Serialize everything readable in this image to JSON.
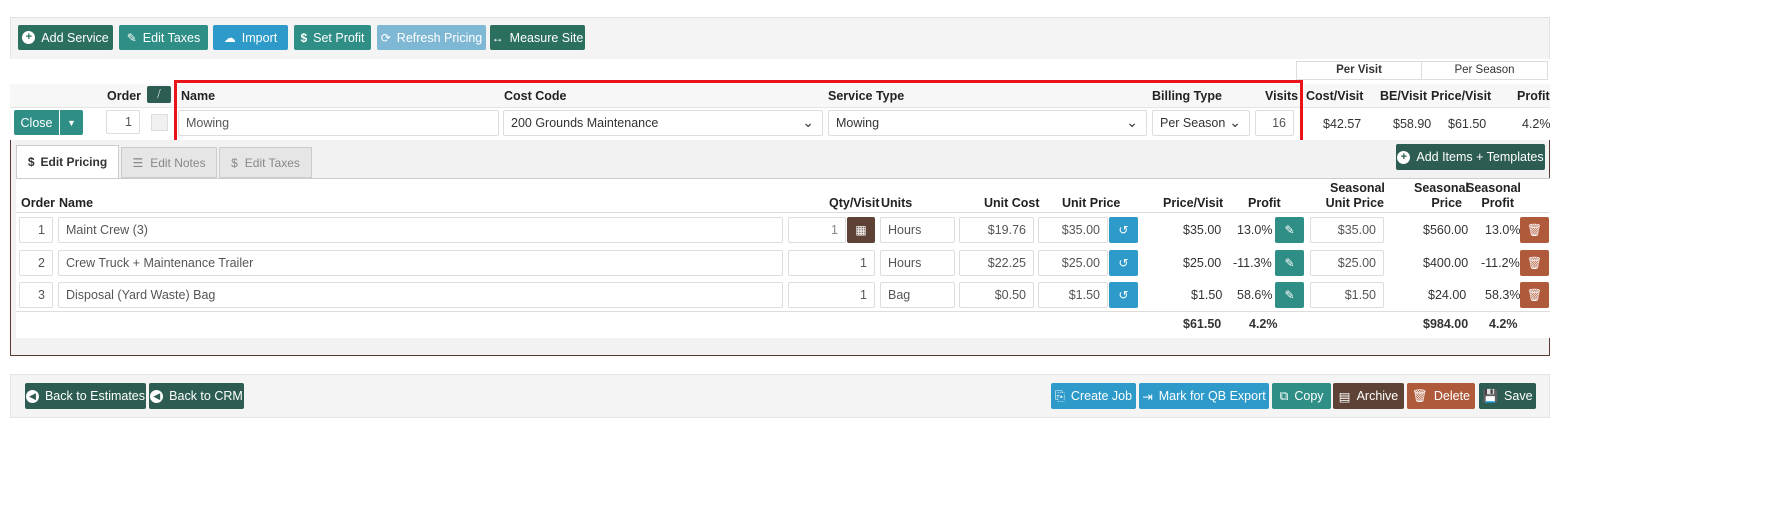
{
  "toolbar": {
    "add_service": "Add Service",
    "edit_taxes": "Edit Taxes",
    "import": "Import",
    "set_profit": "Set Profit",
    "refresh_pricing": "Refresh Pricing",
    "measure_site": "Measure Site"
  },
  "per_tabs": {
    "per_visit": "Per Visit",
    "per_season": "Per Season"
  },
  "service_headers": {
    "order": "Order",
    "name": "Name",
    "cost_code": "Cost Code",
    "service_type": "Service Type",
    "billing_type": "Billing Type",
    "visits": "Visits",
    "cost_visit": "Cost/Visit",
    "be_visit": "BE/Visit",
    "price_visit": "Price/Visit",
    "profit": "Profit"
  },
  "service": {
    "close": "Close",
    "order": "1",
    "name": "Mowing",
    "cost_code": "200 Grounds Maintenance",
    "service_type": "Mowing",
    "billing_type": "Per Season",
    "visits": "16",
    "cost_visit": "$42.57",
    "be_visit": "$58.90",
    "price_visit": "$61.50",
    "profit": "4.2%"
  },
  "tabs": {
    "edit_pricing": "Edit Pricing",
    "edit_notes": "Edit Notes",
    "edit_taxes": "Edit Taxes"
  },
  "add_items": "Add Items + Templates",
  "item_headers": {
    "order": "Order",
    "name": "Name",
    "qty_visit": "Qty/Visit",
    "units": "Units",
    "unit_cost": "Unit Cost",
    "unit_price": "Unit Price",
    "price_visit": "Price/Visit",
    "profit": "Profit",
    "seasonal_unit_price_1": "Seasonal",
    "seasonal_unit_price_2": "Unit Price",
    "seasonal_price_1": "Seasonal",
    "seasonal_price_2": "Price",
    "seasonal_profit_1": "Seasonal",
    "seasonal_profit_2": "Profit"
  },
  "items": [
    {
      "order": "1",
      "name": "Maint Crew (3)",
      "qty": "1",
      "units": "Hours",
      "unit_cost": "$19.76",
      "unit_price": "$35.00",
      "price_visit": "$35.00",
      "profit": "13.0%",
      "seasonal_unit_price": "$35.00",
      "seasonal_price": "$560.00",
      "seasonal_profit": "13.0%"
    },
    {
      "order": "2",
      "name": "Crew Truck + Maintenance Trailer",
      "qty": "1",
      "units": "Hours",
      "unit_cost": "$22.25",
      "unit_price": "$25.00",
      "price_visit": "$25.00",
      "profit": "-11.3%",
      "seasonal_unit_price": "$25.00",
      "seasonal_price": "$400.00",
      "seasonal_profit": "-11.2%"
    },
    {
      "order": "3",
      "name": "Disposal (Yard Waste) Bag",
      "qty": "1",
      "units": "Bag",
      "unit_cost": "$0.50",
      "unit_price": "$1.50",
      "price_visit": "$1.50",
      "profit": "58.6%",
      "seasonal_unit_price": "$1.50",
      "seasonal_price": "$24.00",
      "seasonal_profit": "58.3%"
    }
  ],
  "totals": {
    "price_visit": "$61.50",
    "profit": "4.2%",
    "seasonal_price": "$984.00",
    "seasonal_profit": "4.2%"
  },
  "footer": {
    "back_estimates": "Back to Estimates",
    "back_crm": "Back to CRM",
    "create_job": "Create Job",
    "mark_qb": "Mark for QB Export",
    "copy": "Copy",
    "archive": "Archive",
    "delete": "Delete",
    "save": "Save"
  },
  "colors": {
    "primary_green": "#2b6f5e",
    "teal": "#2f8f86",
    "blue": "#2d9ac9",
    "brown": "#5e4236",
    "rust": "#b05a3c",
    "highlight": "#e8131b"
  }
}
